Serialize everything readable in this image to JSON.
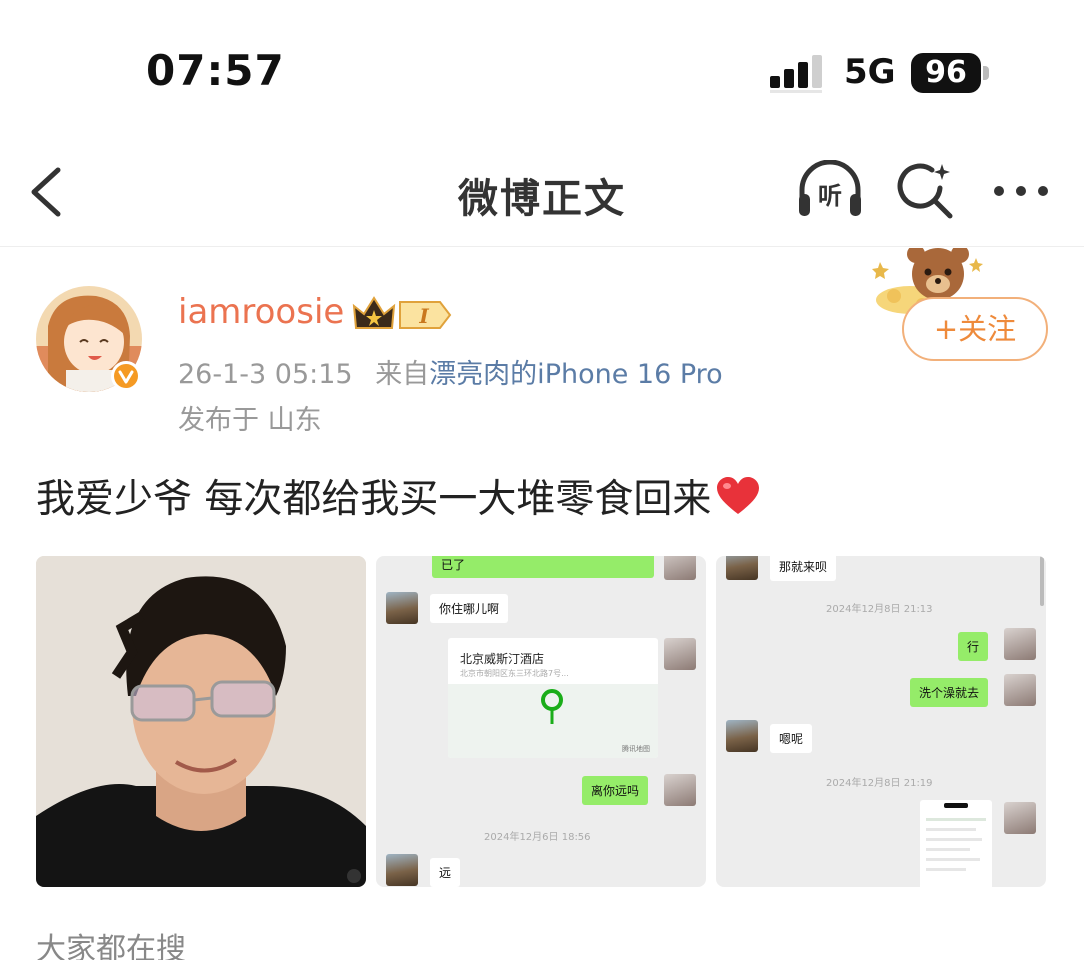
{
  "status_bar": {
    "time": "07:57",
    "network": "5G",
    "battery": "96"
  },
  "nav": {
    "title": "微博正文",
    "listen_label": "听",
    "icons": [
      "back-icon",
      "listen-icon",
      "search-icon",
      "more-icon"
    ]
  },
  "author": {
    "username": "iamroosie",
    "badge_text": "I",
    "time": "26-1-3 05:15",
    "source_prefix": "来自",
    "source_device": "漂亮肉的iPhone 16 Pro",
    "location": "发布于 山东",
    "follow_label": "+关注"
  },
  "post": {
    "text": "我爱少爷 每次都给我买一大堆零食回来"
  },
  "images": {
    "chat1": {
      "msg_top": "已了",
      "msg_where": "你住哪儿啊",
      "loc_name": "北京威斯汀酒店",
      "loc_addr": "北京市朝阳区东三环北路7号...",
      "loc_source": "腾讯地图",
      "msg_far": "离你远吗",
      "timestamp": "2024年12月6日 18:56",
      "msg_yuan": "远"
    },
    "chat2": {
      "msg_top": "那就来呗",
      "timestamp1": "2024年12月8日 21:13",
      "msg_ok": "行",
      "msg_shower": "洗个澡就去",
      "msg_en": "嗯呢",
      "timestamp2": "2024年12月8日 21:19"
    }
  },
  "section": {
    "title": "大家都在搜"
  },
  "colors": {
    "username": "#eb7350",
    "follow": "#ee8a3b",
    "link": "#5b7ca6",
    "wechat_green": "#95ec69"
  }
}
